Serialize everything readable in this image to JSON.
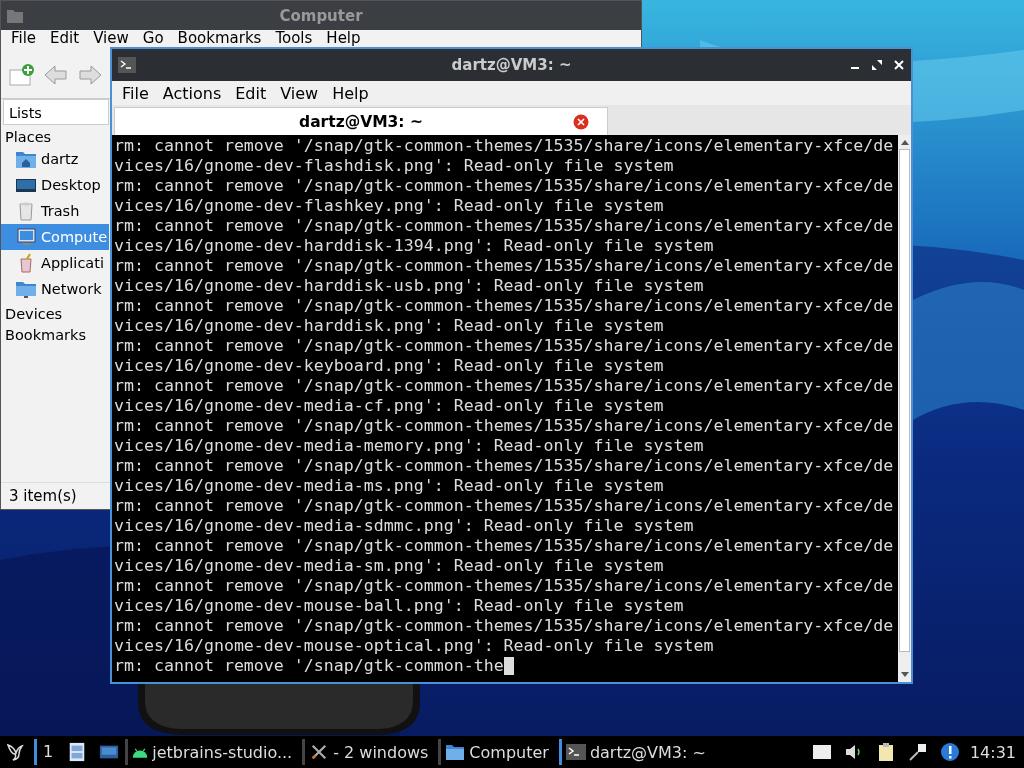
{
  "file_manager": {
    "title": "Computer",
    "menu": [
      "File",
      "Edit",
      "View",
      "Go",
      "Bookmarks",
      "Tools",
      "Help"
    ],
    "toolbar": [
      {
        "kind": "new-folder"
      },
      {
        "kind": "back"
      },
      {
        "kind": "forward"
      }
    ],
    "sidebar_header": "Lists",
    "sections": [
      {
        "label": "Places",
        "items": [
          {
            "label": "dartz",
            "selected": false
          },
          {
            "label": "Desktop",
            "selected": false
          },
          {
            "label": "Trash",
            "selected": false
          },
          {
            "label": "Compute",
            "selected": true
          },
          {
            "label": "Applicati",
            "selected": false
          },
          {
            "label": "Network",
            "selected": false
          }
        ]
      },
      {
        "label": "Devices"
      },
      {
        "label": "Bookmarks"
      }
    ],
    "status": "3 item(s)"
  },
  "terminal": {
    "title": "dartz@VM3: ~",
    "menu": [
      "File",
      "Actions",
      "Edit",
      "View",
      "Help"
    ],
    "tab": "dartz@VM3: ~",
    "lines": [
      "rm: cannot remove '/snap/gtk-common-themes/1535/share/icons/elementary-xfce/de",
      "vices/16/gnome-dev-flashdisk.png': Read-only file system",
      "rm: cannot remove '/snap/gtk-common-themes/1535/share/icons/elementary-xfce/de",
      "vices/16/gnome-dev-flashkey.png': Read-only file system",
      "rm: cannot remove '/snap/gtk-common-themes/1535/share/icons/elementary-xfce/de",
      "vices/16/gnome-dev-harddisk-1394.png': Read-only file system",
      "rm: cannot remove '/snap/gtk-common-themes/1535/share/icons/elementary-xfce/de",
      "vices/16/gnome-dev-harddisk-usb.png': Read-only file system",
      "rm: cannot remove '/snap/gtk-common-themes/1535/share/icons/elementary-xfce/de",
      "vices/16/gnome-dev-harddisk.png': Read-only file system",
      "rm: cannot remove '/snap/gtk-common-themes/1535/share/icons/elementary-xfce/de",
      "vices/16/gnome-dev-keyboard.png': Read-only file system",
      "rm: cannot remove '/snap/gtk-common-themes/1535/share/icons/elementary-xfce/de",
      "vices/16/gnome-dev-media-cf.png': Read-only file system",
      "rm: cannot remove '/snap/gtk-common-themes/1535/share/icons/elementary-xfce/de",
      "vices/16/gnome-dev-media-memory.png': Read-only file system",
      "rm: cannot remove '/snap/gtk-common-themes/1535/share/icons/elementary-xfce/de",
      "vices/16/gnome-dev-media-ms.png': Read-only file system",
      "rm: cannot remove '/snap/gtk-common-themes/1535/share/icons/elementary-xfce/de",
      "vices/16/gnome-dev-media-sdmmc.png': Read-only file system",
      "rm: cannot remove '/snap/gtk-common-themes/1535/share/icons/elementary-xfce/de",
      "vices/16/gnome-dev-media-sm.png': Read-only file system",
      "rm: cannot remove '/snap/gtk-common-themes/1535/share/icons/elementary-xfce/de",
      "vices/16/gnome-dev-mouse-ball.png': Read-only file system",
      "rm: cannot remove '/snap/gtk-common-themes/1535/share/icons/elementary-xfce/de",
      "vices/16/gnome-dev-mouse-optical.png': Read-only file system",
      "rm: cannot remove '/snap/gtk-common-the"
    ]
  },
  "taskbar": {
    "workspace": "1",
    "launchers": [
      {
        "kind": "file-cabinet"
      },
      {
        "kind": "screen"
      }
    ],
    "tasks": [
      {
        "label": "jetbrains-studio...",
        "selected": false
      },
      {
        "label": "- 2 windows",
        "selected": false
      },
      {
        "label": "Computer",
        "selected": false
      },
      {
        "label": "dartz@VM3: ~",
        "selected": true
      }
    ],
    "tray": [
      {
        "kind": "drive"
      },
      {
        "kind": "speaker"
      },
      {
        "kind": "clipboard"
      },
      {
        "kind": "network"
      },
      {
        "kind": "info"
      }
    ],
    "clock": "14:31"
  }
}
